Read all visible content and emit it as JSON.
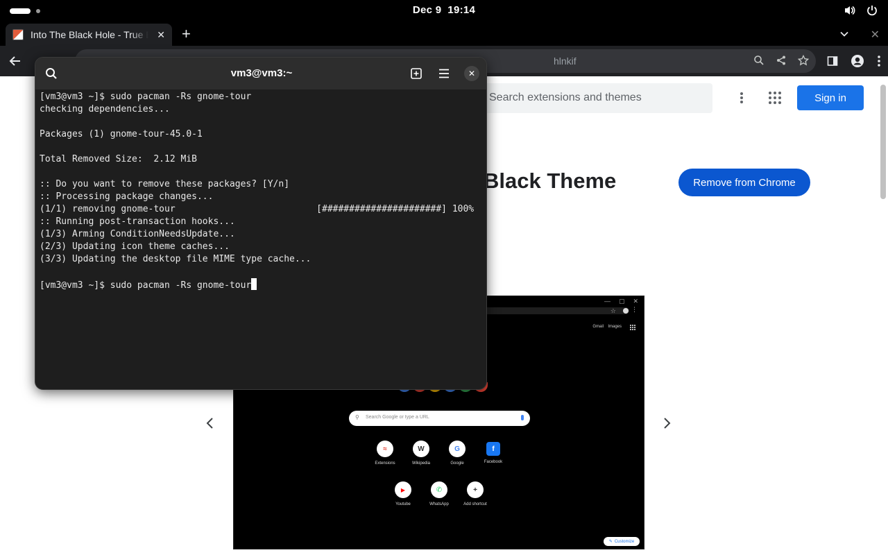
{
  "gnome_topbar": {
    "date": "Dec 9",
    "time": "19:14"
  },
  "browser": {
    "tab": {
      "title": "Into The Black Hole - True Black Theme"
    },
    "omnibox": {
      "url_visible_fragment": "hlnkif"
    }
  },
  "page": {
    "search_placeholder": "Search extensions and themes",
    "sign_in_label": "Sign in",
    "theme_title_visible": "Black Theme",
    "remove_button_label": "Remove from Chrome",
    "preview": {
      "search_placeholder": "Search Google or type a URL",
      "gmail_label": "Gmail",
      "images_label": "Images",
      "shortcuts": [
        {
          "label": "Extensions",
          "glyph": "≈",
          "color": "#e34133"
        },
        {
          "label": "Wikipedia",
          "glyph": "W",
          "color": "#333333"
        },
        {
          "label": "Google",
          "glyph": "G",
          "color": "#4285f4"
        },
        {
          "label": "Facebook",
          "glyph": "f",
          "color": "#1877f2"
        },
        {
          "label": "Youtube",
          "glyph": "▶",
          "color": "#ff0000"
        },
        {
          "label": "WhatsApp",
          "glyph": "✆",
          "color": "#25d366"
        },
        {
          "label": "Add shortcut",
          "glyph": "+",
          "color": "#333333"
        }
      ],
      "customize_label": "Customize"
    }
  },
  "terminal": {
    "title": "vm3@vm3:~",
    "lines": [
      "[vm3@vm3 ~]$ sudo pacman -Rs gnome-tour",
      "checking dependencies...",
      "",
      "Packages (1) gnome-tour-45.0-1",
      "",
      "Total Removed Size:  2.12 MiB",
      "",
      ":: Do you want to remove these packages? [Y/n]",
      ":: Processing package changes...",
      "(1/1) removing gnome-tour                          [######################] 100%",
      ":: Running post-transaction hooks...",
      "(1/3) Arming ConditionNeedsUpdate...",
      "(2/3) Updating icon theme caches...",
      "(3/3) Updating the desktop file MIME type cache...",
      ""
    ],
    "prompt_line": "[vm3@vm3 ~]$ sudo pacman -Rs gnome-tour"
  },
  "colors": {
    "chrome_blue": "#1a73e8",
    "remove_button": "#0b57d0",
    "terminal_bg": "#1e1e1e"
  }
}
